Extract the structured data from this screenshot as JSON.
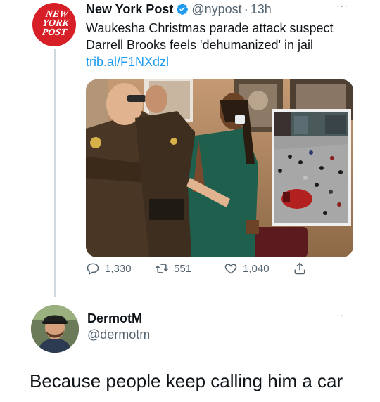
{
  "tweet": {
    "logo_lines": [
      "NEW",
      "YORK",
      "POST"
    ],
    "author_name": "New York Post",
    "handle": "@nypost",
    "separator": "·",
    "time": "13h",
    "more": "···",
    "text": "Waukesha Christmas parade attack suspect Darrell Brooks feels 'dehumanized' in jail",
    "link": "trib.al/F1NXdzl",
    "media_icons": [
      "courtroom-photo",
      "parade-inset-photo"
    ],
    "actions": {
      "replies": "1,330",
      "retweets": "551",
      "likes": "1,040"
    }
  },
  "reply": {
    "author_name": "DermotM",
    "handle": "@dermotm",
    "more": "···",
    "text": "Because people keep calling him a car"
  },
  "colors": {
    "nyp_red": "#d61f26",
    "verified_blue": "#1d9bf0",
    "link_blue": "#1d9bf0",
    "muted": "#536471",
    "thread_line": "#cfd9de"
  }
}
